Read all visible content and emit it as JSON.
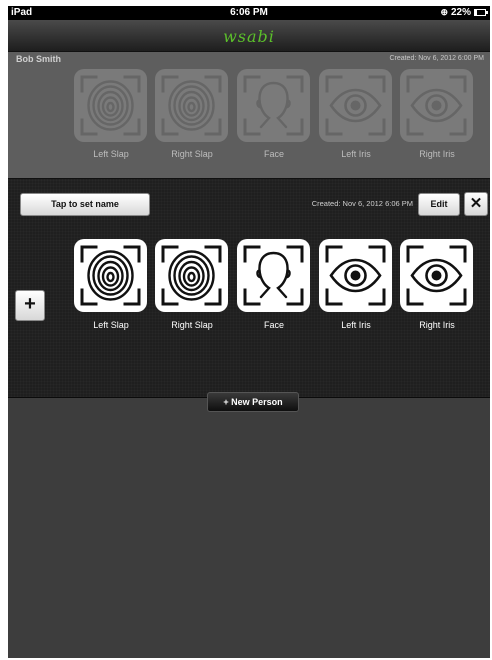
{
  "status_bar": {
    "carrier": "iPad",
    "time": "6:06 PM",
    "battery": "22%",
    "battery_level": 0.22
  },
  "navbar": {
    "logo": "wsabi"
  },
  "person_previous": {
    "name": "Bob Smith",
    "created": "Created: Nov 6, 2012 6:00 PM",
    "tiles": [
      {
        "icon": "fingerprint-icon",
        "label": "Left Slap"
      },
      {
        "icon": "fingerprint-icon",
        "label": "Right Slap"
      },
      {
        "icon": "face-icon",
        "label": "Face"
      },
      {
        "icon": "eye-icon",
        "label": "Left Iris"
      },
      {
        "icon": "eye-icon",
        "label": "Right Iris"
      }
    ]
  },
  "person_current": {
    "name_button": "Tap to set name",
    "created": "Created: Nov 6, 2012 6:06 PM",
    "edit_button": "Edit",
    "close_button": "✕",
    "add_button": "+",
    "tiles": [
      {
        "icon": "fingerprint-icon",
        "label": "Left Slap"
      },
      {
        "icon": "fingerprint-icon",
        "label": "Right Slap"
      },
      {
        "icon": "face-icon",
        "label": "Face"
      },
      {
        "icon": "eye-icon",
        "label": "Left Iris"
      },
      {
        "icon": "eye-icon",
        "label": "Right Iris"
      }
    ]
  },
  "new_person_button": "+ New Person"
}
